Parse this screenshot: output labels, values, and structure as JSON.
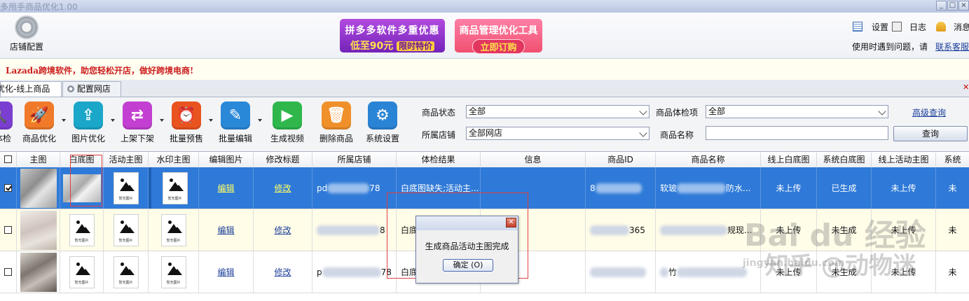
{
  "window": {
    "title": "多甩手商品优化1.00",
    "controls": [
      "_",
      "□",
      "×"
    ]
  },
  "topbar": {
    "shop_config_label": "店铺配置",
    "banner1": {
      "line1": "拼多多软件多重优惠",
      "line2": "低至90元",
      "tag": "限时特价"
    },
    "banner2": {
      "line1": "商品管理优化工具",
      "button": "立即订购"
    },
    "settings": "设置",
    "log": "日志",
    "messages": "消息",
    "help_text": "使用时遇到问题，请",
    "contact": "联系客服"
  },
  "slogan": "Lazada跨境软件，助您轻松开店，做好跨境电商!",
  "tabs": {
    "active": "优化-线上商品",
    "other": "配置网店"
  },
  "toolbar": {
    "items": [
      {
        "label": "体检",
        "color": "#7a3fd0",
        "glyph": "🔍"
      },
      {
        "label": "商品优化",
        "color": "#f07a2a",
        "glyph": "🚀"
      },
      {
        "label": "图片优化",
        "color": "#1aa7c9",
        "glyph": "⇪"
      },
      {
        "label": "上架下架",
        "color": "#c23fd1",
        "glyph": "⇄"
      },
      {
        "label": "批量预售",
        "color": "#e9531f",
        "glyph": "⏰"
      },
      {
        "label": "批量编辑",
        "color": "#2a88d8",
        "glyph": "✎"
      },
      {
        "label": "生成视频",
        "color": "#2fb74c",
        "glyph": "▶"
      },
      {
        "label": "删除商品",
        "color": "#f0902a",
        "glyph": "🗑"
      },
      {
        "label": "系统设置",
        "color": "#2a84d6",
        "glyph": "⚙"
      }
    ]
  },
  "filters": {
    "status_label": "商品状态",
    "status_value": "全部",
    "check_label": "商品体检项",
    "check_value": "全部",
    "shop_label": "所属店铺",
    "shop_value": "全部网店",
    "name_label": "商品名称",
    "name_value": "",
    "advanced": "高级查询",
    "query": "查询"
  },
  "grid": {
    "columns": [
      "主图",
      "白底图",
      "活动主图",
      "水印主图",
      "编辑图片",
      "修改标题",
      "所属店铺",
      "体检结果",
      "信息",
      "商品ID",
      "商品名称",
      "线上白底图",
      "系统白底图",
      "线上活动主图",
      "系统"
    ],
    "placeholder_caption": "暂无图片",
    "rows": [
      {
        "checked": true,
        "edit": "编辑",
        "modify": "修改",
        "shop_pre": "pd",
        "shop_suf": "78",
        "check": "白底图缺失;活动主...",
        "id_pre": "8",
        "id_suf": "",
        "name_pre": "软玻",
        "name_suf": "防水...",
        "online_white": "未上传",
        "sys_white": "已生成",
        "online_act": "未上传",
        "sys": "未"
      },
      {
        "checked": false,
        "edit": "编辑",
        "modify": "修改",
        "shop_pre": "",
        "shop_suf": "8",
        "check": "白底",
        "id_pre": "",
        "id_suf": "365",
        "name_pre": "",
        "name_suf": "规现...",
        "online_white": "未上传",
        "sys_white": "未生成",
        "online_act": "未上传",
        "sys": "未"
      },
      {
        "checked": false,
        "edit": "编辑",
        "modify": "修改",
        "shop_pre": "p",
        "shop_suf": "78",
        "check": "白底",
        "id_pre": "",
        "id_suf": "",
        "name_pre": "竹",
        "name_suf": "",
        "online_white": "未上传",
        "sys_white": "未生成",
        "online_act": "未上传",
        "sys": "未"
      }
    ]
  },
  "dialog": {
    "message": "生成商品活动主图完成",
    "ok": "确定 (O)"
  },
  "watermarks": {
    "baidu": "Bai du 经验",
    "zhihu": "知乎 @动物迷",
    "url": "jingyan.baidu.com"
  }
}
